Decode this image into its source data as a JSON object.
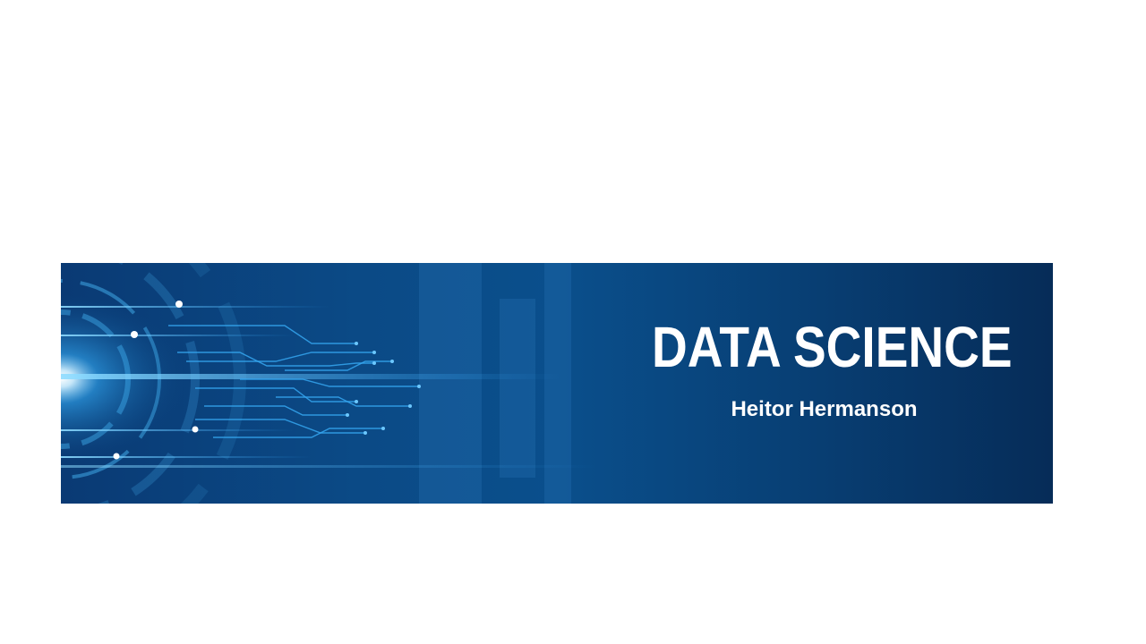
{
  "slide": {
    "title": "DATA SCIENCE",
    "author": "Heitor Hermanson"
  },
  "banner": {
    "art": "circuit-tech-graphic",
    "colors": {
      "background": "#0a4a86",
      "accent": "#2fa8ff",
      "text": "#ffffff"
    }
  }
}
